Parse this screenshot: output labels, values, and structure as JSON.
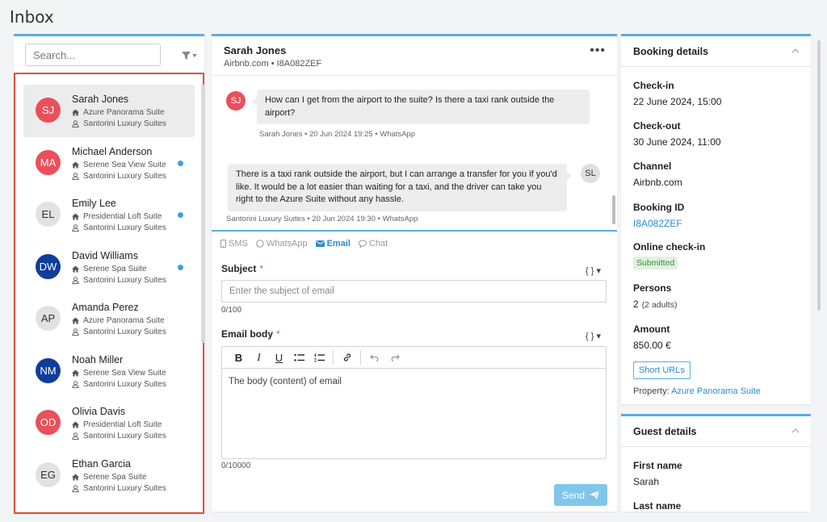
{
  "page": {
    "title": "Inbox"
  },
  "search": {
    "placeholder": "Search..."
  },
  "contacts": [
    {
      "initials": "SJ",
      "name": "Sarah Jones",
      "room": "Azure Panorama Suite",
      "property": "Santorini Luxury Suites",
      "avatar_color": "#e9505b",
      "avatar_text": "#ffffff",
      "unread": false,
      "active": true
    },
    {
      "initials": "MA",
      "name": "Michael Anderson",
      "room": "Serene Sea View Suite",
      "property": "Santorini Luxury Suites",
      "avatar_color": "#e9505b",
      "avatar_text": "#ffffff",
      "unread": true,
      "active": false
    },
    {
      "initials": "EL",
      "name": "Emily Lee",
      "room": "Presidential Loft Suite",
      "property": "Santorini Luxury Suites",
      "avatar_color": "#e2e2e2",
      "avatar_text": "#333333",
      "unread": true,
      "active": false
    },
    {
      "initials": "DW",
      "name": "David Williams",
      "room": "Serene Spa Suite",
      "property": "Santorini Luxury Suites",
      "avatar_color": "#0f3d9a",
      "avatar_text": "#ffffff",
      "unread": true,
      "active": false
    },
    {
      "initials": "AP",
      "name": "Amanda Perez",
      "room": "Azure Panorama Suite",
      "property": "Santorini Luxury Suites",
      "avatar_color": "#e2e2e2",
      "avatar_text": "#333333",
      "unread": false,
      "active": false
    },
    {
      "initials": "NM",
      "name": "Noah Miller",
      "room": "Serene Sea View Suite",
      "property": "Santorini Luxury Suites",
      "avatar_color": "#0f3d9a",
      "avatar_text": "#ffffff",
      "unread": false,
      "active": false
    },
    {
      "initials": "OD",
      "name": "Olivia Davis",
      "room": "Presidential Loft Suite",
      "property": "Santorini Luxury Suites",
      "avatar_color": "#e9505b",
      "avatar_text": "#ffffff",
      "unread": false,
      "active": false
    },
    {
      "initials": "EG",
      "name": "Ethan Garcia",
      "room": "Serene Spa Suite",
      "property": "Santorini Luxury Suites",
      "avatar_color": "#e2e2e2",
      "avatar_text": "#333333",
      "unread": false,
      "active": false
    }
  ],
  "conversation": {
    "name": "Sarah Jones",
    "subtitle": "Airbnb.com • I8A082ZEF",
    "more_label": "•••",
    "messages": [
      {
        "direction": "in",
        "avatar": "SJ",
        "text": "How can I get from the airport to the suite? Is there a taxi rank outside the airport?",
        "meta": "Sarah Jones • 20 Jun 2024 19:25 • WhatsApp"
      },
      {
        "direction": "out",
        "avatar": "SL",
        "text": "There is a taxi rank outside the airport, but I can arrange a transfer for you if you'd like. It would be a lot easier than waiting for a taxi, and the driver can take you right to the Azure Suite without any hassle.",
        "meta": "Santorini Luxury Suites • 20 Jun 2024 19:30 • WhatsApp"
      }
    ]
  },
  "compose": {
    "tabs": [
      {
        "label": "SMS",
        "icon": "phone-icon",
        "active": false
      },
      {
        "label": "WhatsApp",
        "icon": "whatsapp-icon",
        "active": false
      },
      {
        "label": "Email",
        "icon": "envelope-icon",
        "active": true
      },
      {
        "label": "Chat",
        "icon": "chat-bubble-icon",
        "active": false
      }
    ],
    "subject_label": "Subject",
    "required_mark": "*",
    "variables_label": "{ } ▾",
    "subject_placeholder": "Enter the subject of email",
    "subject_counter": "0/100",
    "body_label": "Email body",
    "body_text": "The body (content) of email",
    "body_counter": "0/10000",
    "toolbar": {
      "bold": "B",
      "italic": "I",
      "underline": "U"
    },
    "send_label": "Send"
  },
  "booking": {
    "title": "Booking details",
    "checkin_label": "Check-in",
    "checkin_value": "22 June 2024, 15:00",
    "checkout_label": "Check-out",
    "checkout_value": "30 June 2024, 11:00",
    "channel_label": "Channel",
    "channel_value": "Airbnb.com",
    "booking_id_label": "Booking ID",
    "booking_id_value": "I8A082ZEF",
    "online_checkin_label": "Online check-in",
    "online_checkin_value": "Submitted",
    "persons_label": "Persons",
    "persons_value": "2",
    "persons_sub": "(2 adults)",
    "amount_label": "Amount",
    "amount_value": "850.00 €",
    "short_urls_label": "Short URLs",
    "property_label": "Property:",
    "property_value": "Azure Panorama Suite"
  },
  "guest": {
    "title": "Guest details",
    "first_name_label": "First name",
    "first_name_value": "Sarah",
    "last_name_label": "Last name"
  },
  "colors": {
    "accent": "#57aee0",
    "link": "#2b8bd0",
    "selection_frame": "#e05236",
    "send": "#80c6ec",
    "unread": "#3b9fe0"
  }
}
